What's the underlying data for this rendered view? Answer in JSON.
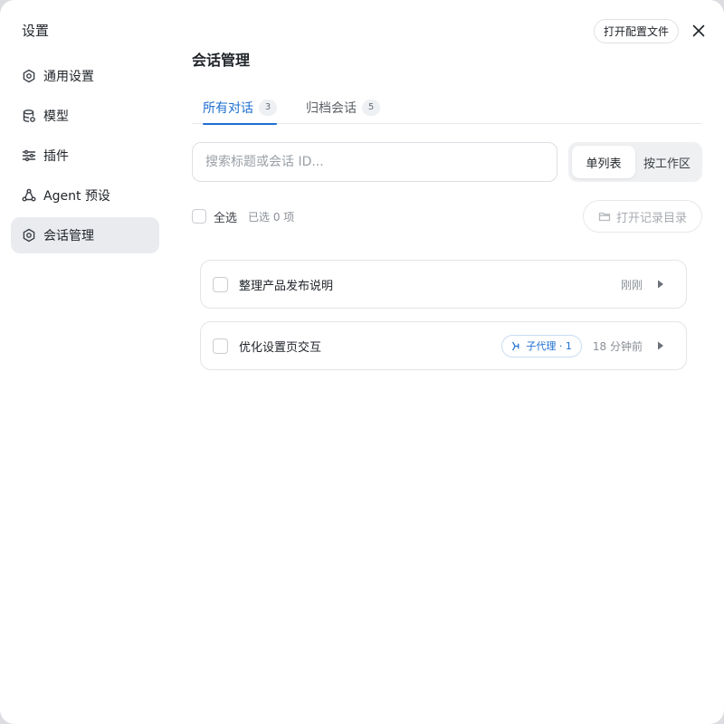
{
  "sidebar": {
    "title": "设置",
    "items": [
      {
        "label": "通用设置",
        "icon": "gear-icon"
      },
      {
        "label": "模型",
        "icon": "database-icon"
      },
      {
        "label": "插件",
        "icon": "sliders-icon"
      },
      {
        "label": "Agent 预设",
        "icon": "agent-icon"
      },
      {
        "label": "会话管理",
        "icon": "gear-icon",
        "active": true
      }
    ]
  },
  "header": {
    "open_config_label": "打开配置文件",
    "close_icon": "close-icon"
  },
  "main": {
    "title": "会话管理",
    "tabs": [
      {
        "label": "所有对话",
        "count": "3",
        "active": true
      },
      {
        "label": "归档会话",
        "count": "5"
      }
    ],
    "search": {
      "placeholder": "搜索标题或会话 ID...",
      "value": ""
    },
    "view_toggle": [
      {
        "label": "单列表",
        "active": true
      },
      {
        "label": "按工作区"
      }
    ],
    "select_all_label": "全选",
    "selected_count": "已选 0 项",
    "open_dir_label": "打开记录目录",
    "sessions": [
      {
        "title": "整理产品发布说明",
        "time": "刚刚"
      },
      {
        "title": "优化设置页交互",
        "time": "18 分钟前",
        "badge": "子代理 · 1"
      }
    ]
  },
  "colors": {
    "accent": "#1f6fd1",
    "active_nav_bg": "#e9ebef",
    "border": "#e3e5e8"
  }
}
